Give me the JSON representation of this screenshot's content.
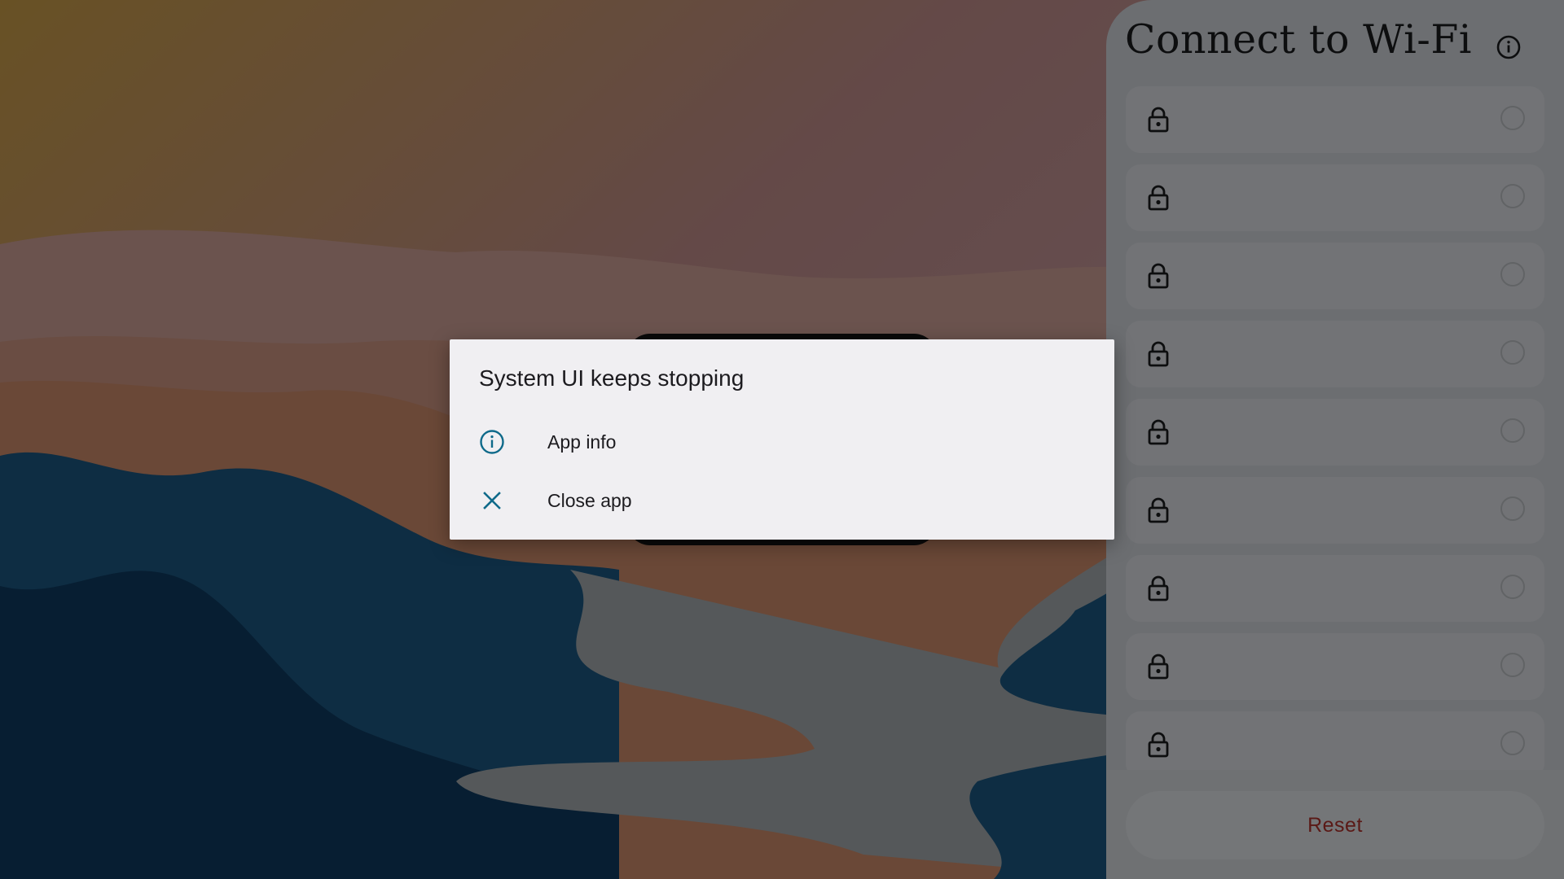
{
  "wifi_panel": {
    "title": "Connect to Wi-Fi",
    "info_icon": "info-icon",
    "networks": [
      {
        "ssid": "",
        "icon": "lock-icon"
      },
      {
        "ssid": "",
        "icon": "lock-icon"
      },
      {
        "ssid": "",
        "icon": "lock-icon"
      },
      {
        "ssid": "",
        "icon": "lock-icon"
      },
      {
        "ssid": "",
        "icon": "lock-icon"
      },
      {
        "ssid": "",
        "icon": "lock-icon"
      },
      {
        "ssid": "",
        "icon": "lock-icon"
      },
      {
        "ssid": "",
        "icon": "lock-icon"
      },
      {
        "ssid": "",
        "icon": "lock-icon"
      }
    ],
    "reset_label": "Reset",
    "reset_color": "#b5332d"
  },
  "dialog": {
    "title": "System UI keeps stopping",
    "options": [
      {
        "label": "App info",
        "icon": "info-icon"
      },
      {
        "label": "Close app",
        "icon": "close-icon"
      }
    ],
    "accent_color": "#0f6a8a"
  }
}
